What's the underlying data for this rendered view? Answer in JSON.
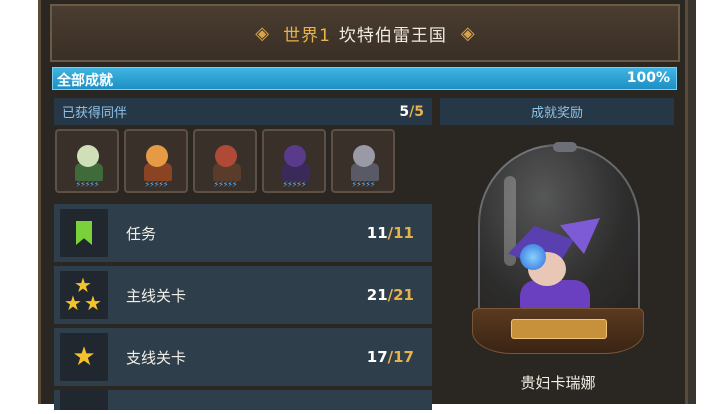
{
  "header": {
    "world_label": "世界1",
    "world_name": "坎特伯雷王国"
  },
  "progress": {
    "label": "全部成就",
    "percent_text": "100%",
    "value": 1.0
  },
  "companions": {
    "title": "已获得同伴",
    "count_current": "5",
    "count_total": "/5",
    "portraits": [
      {
        "name": "companion-green-haired",
        "head_color": "#cfe0b8",
        "body_color": "#3f6a3a"
      },
      {
        "name": "companion-orange-fruit",
        "head_color": "#e79a44",
        "body_color": "#8a4424"
      },
      {
        "name": "companion-red-haired",
        "head_color": "#b04a36",
        "body_color": "#5a3c2a"
      },
      {
        "name": "companion-purple-haired",
        "head_color": "#5a3a8a",
        "body_color": "#3a2a5a"
      },
      {
        "name": "companion-gray-creature",
        "head_color": "#9a9aa6",
        "body_color": "#5a5a66"
      }
    ]
  },
  "achievements": [
    {
      "name": "row-tasks",
      "icon": "bookmark-icon",
      "label": "任务",
      "current": "11",
      "total": "/11"
    },
    {
      "name": "row-main-stages",
      "icon": "three-stars-icon",
      "label": "主线关卡",
      "current": "21",
      "total": "/21"
    },
    {
      "name": "row-side-stages",
      "icon": "star-icon",
      "label": "支线关卡",
      "current": "17",
      "total": "/17"
    }
  ],
  "reward": {
    "title": "成就奖励",
    "character_name": "贵妇卡瑞娜"
  },
  "colors": {
    "accent_gold": "#e6b34a",
    "progress_blue": "#1d8fc4",
    "panel_blue": "#263848"
  }
}
